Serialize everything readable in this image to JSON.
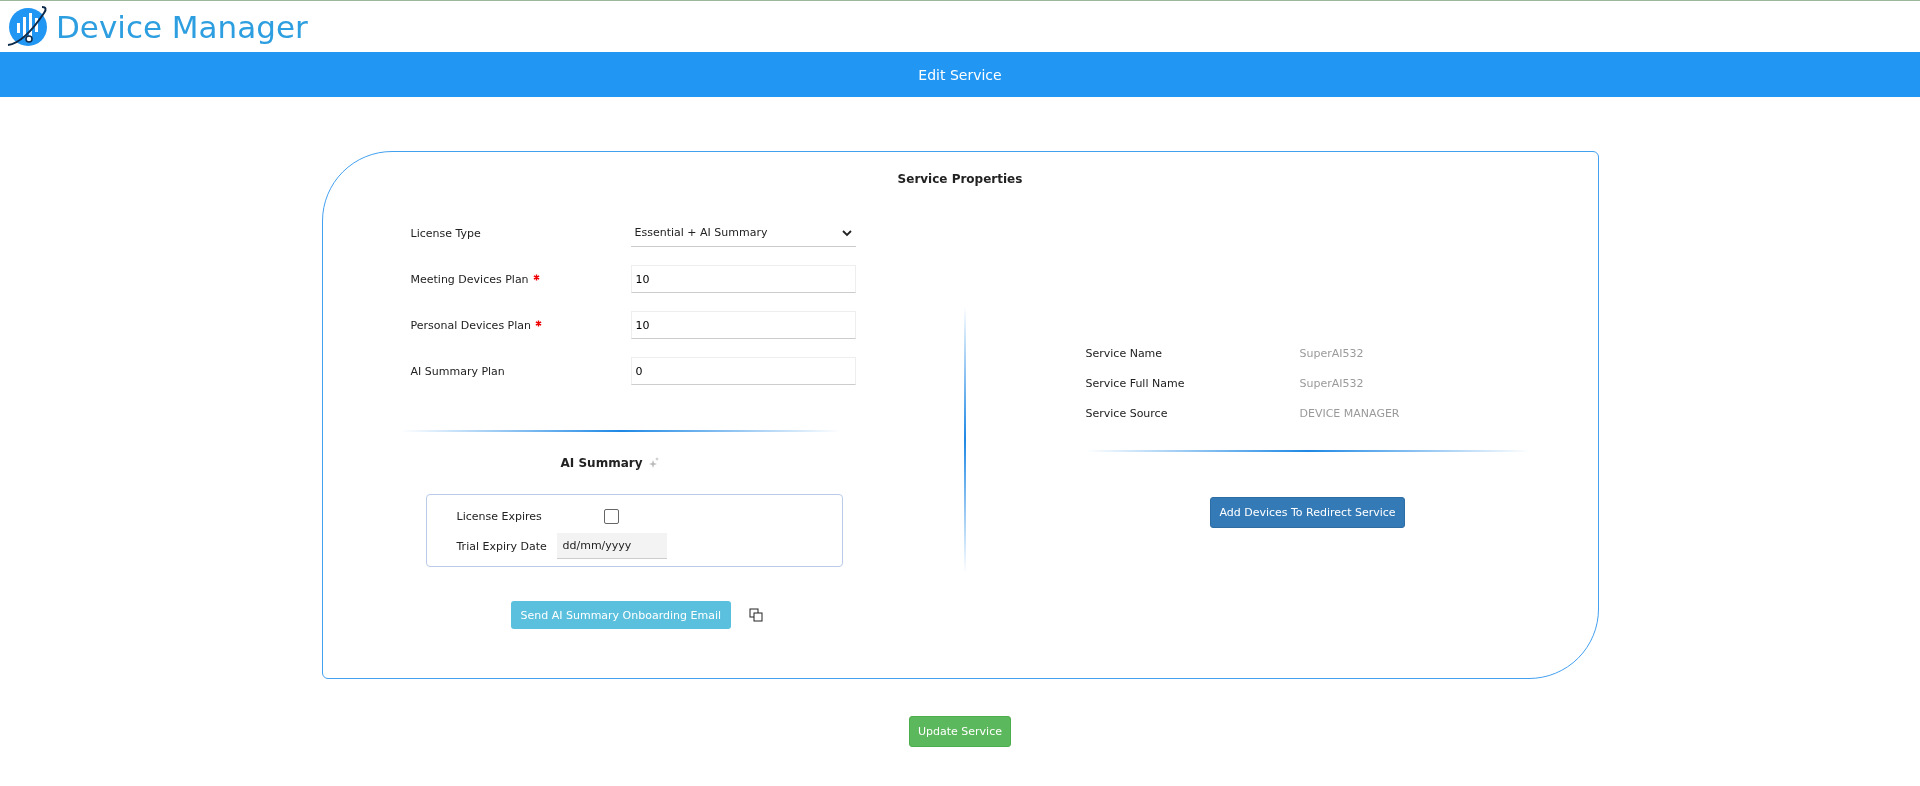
{
  "header": {
    "app_name": "Device Manager"
  },
  "title_bar": {
    "title": "Edit Service"
  },
  "card": {
    "title": "Service Properties",
    "fields": [
      {
        "kind": "select",
        "label": "License Type",
        "value": "Essential + AI Summary",
        "required": false
      },
      {
        "kind": "input",
        "label": "Meeting Devices Plan",
        "value": "10",
        "required": true
      },
      {
        "kind": "input",
        "label": "Personal Devices Plan",
        "value": "10",
        "required": true
      },
      {
        "kind": "input",
        "label": "AI Summary Plan",
        "value": "0",
        "required": false
      }
    ],
    "ai_summary": {
      "title": "AI Summary",
      "license_expires": {
        "label": "License Expires",
        "checked": false
      },
      "trial_expiry": {
        "label": "Trial Expiry Date",
        "placeholder": "dd/mm/yyyy"
      },
      "send_button": "Send AI Summary Onboarding Email"
    },
    "info": [
      {
        "label": "Service Name",
        "value": "SuperAI532"
      },
      {
        "label": "Service Full Name",
        "value": "SuperAI532"
      },
      {
        "label": "Service Source",
        "value": "DEVICE MANAGER"
      }
    ],
    "redirect_button": "Add Devices To Redirect Service"
  },
  "update_button": "Update Service"
}
